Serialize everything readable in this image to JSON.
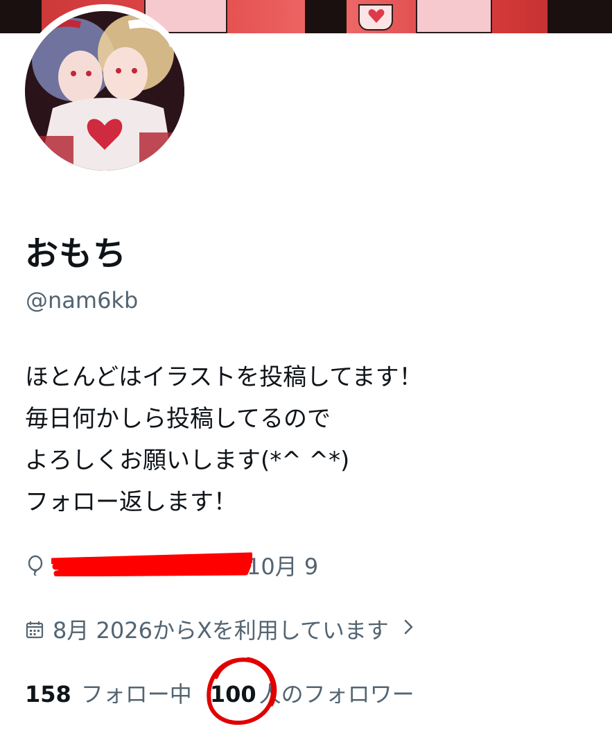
{
  "profile": {
    "display_name": "おもち",
    "handle": "@nam6kb",
    "bio_lines": [
      "ほとんどはイラストを投稿してます！",
      "毎日何かしら投稿してるので",
      "よろしくお願いします(*^ ^*)",
      "フォロー返します！"
    ],
    "birthday_visible": "10月 9",
    "joined_text": "8月 2026からXを利用しています"
  },
  "stats": {
    "following_count": "158",
    "following_label": "フォロー中",
    "followers_count": "100",
    "followers_label": "人のフォロワー"
  },
  "icons": {
    "birthday": "balloon-icon",
    "joined": "calendar-icon",
    "joined_more": "chevron-right-icon"
  },
  "colors": {
    "text_primary": "#0f1419",
    "text_secondary": "#536471",
    "redaction": "#ff0000",
    "annotation_circle": "#e00000"
  }
}
